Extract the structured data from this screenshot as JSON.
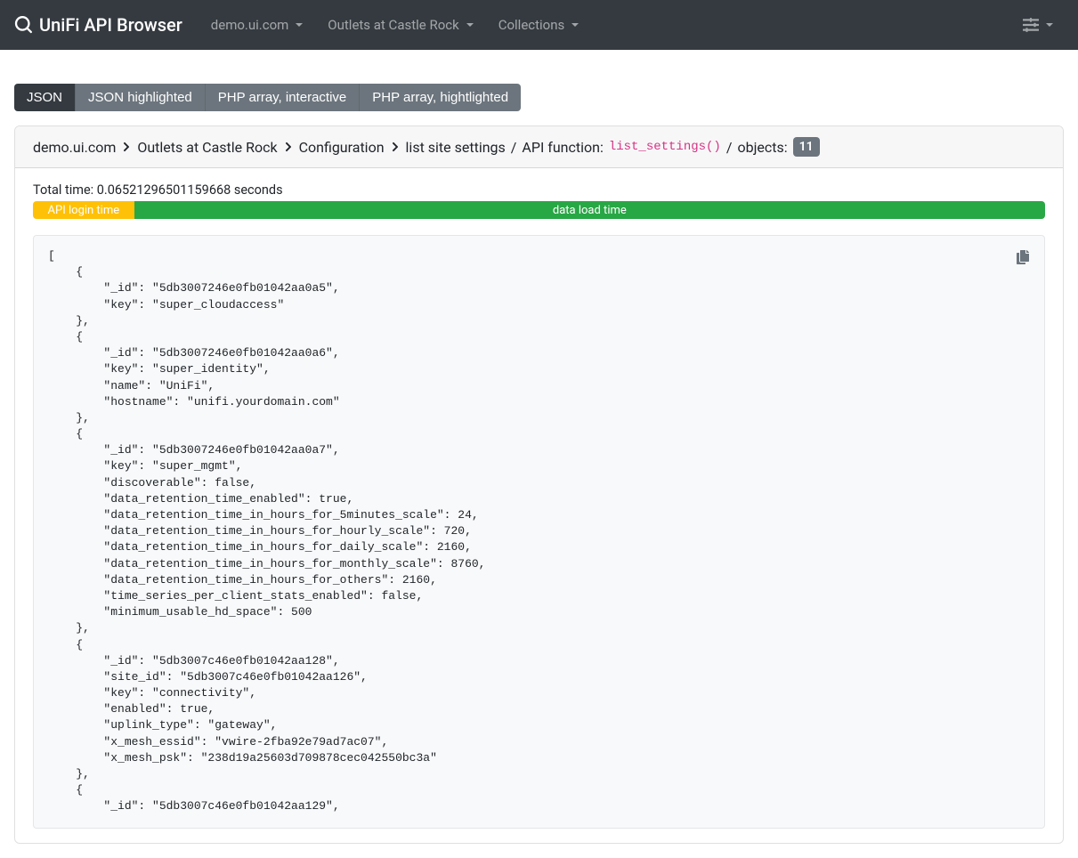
{
  "navbar": {
    "brand": "UniFi API Browser",
    "links": [
      {
        "label": "demo.ui.com"
      },
      {
        "label": "Outlets at Castle Rock"
      },
      {
        "label": "Collections"
      }
    ]
  },
  "tabs": [
    {
      "label": "JSON",
      "active": true
    },
    {
      "label": "JSON highlighted",
      "active": false
    },
    {
      "label": "PHP array, interactive",
      "active": false
    },
    {
      "label": "PHP array, hightlighted",
      "active": false
    }
  ],
  "breadcrumb": {
    "controller": "demo.ui.com",
    "site": "Outlets at Castle Rock",
    "section": "Configuration",
    "page": "list site settings",
    "api_label": "API function:",
    "api_function": "list_settings()",
    "objects_label": "objects:",
    "objects_count": "11"
  },
  "timing": {
    "total_label": "Total time: 0.06521296501159668 seconds",
    "login_label": "API login time",
    "load_label": "data load time"
  },
  "json_output": "[\n    {\n        \"_id\": \"5db3007246e0fb01042aa0a5\",\n        \"key\": \"super_cloudaccess\"\n    },\n    {\n        \"_id\": \"5db3007246e0fb01042aa0a6\",\n        \"key\": \"super_identity\",\n        \"name\": \"UniFi\",\n        \"hostname\": \"unifi.yourdomain.com\"\n    },\n    {\n        \"_id\": \"5db3007246e0fb01042aa0a7\",\n        \"key\": \"super_mgmt\",\n        \"discoverable\": false,\n        \"data_retention_time_enabled\": true,\n        \"data_retention_time_in_hours_for_5minutes_scale\": 24,\n        \"data_retention_time_in_hours_for_hourly_scale\": 720,\n        \"data_retention_time_in_hours_for_daily_scale\": 2160,\n        \"data_retention_time_in_hours_for_monthly_scale\": 8760,\n        \"data_retention_time_in_hours_for_others\": 2160,\n        \"time_series_per_client_stats_enabled\": false,\n        \"minimum_usable_hd_space\": 500\n    },\n    {\n        \"_id\": \"5db3007c46e0fb01042aa128\",\n        \"site_id\": \"5db3007c46e0fb01042aa126\",\n        \"key\": \"connectivity\",\n        \"enabled\": true,\n        \"uplink_type\": \"gateway\",\n        \"x_mesh_essid\": \"vwire-2fba92e79ad7ac07\",\n        \"x_mesh_psk\": \"238d19a25603d709878cec042550bc3a\"\n    },\n    {\n        \"_id\": \"5db3007c46e0fb01042aa129\","
}
